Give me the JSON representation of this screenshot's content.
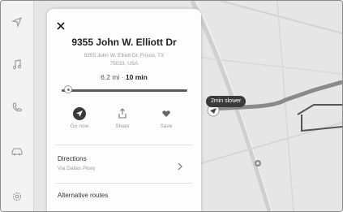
{
  "sidebar": {
    "items": [
      {
        "icon": "navigation-arrow-icon"
      },
      {
        "icon": "music-note-icon"
      },
      {
        "icon": "phone-icon"
      },
      {
        "icon": "car-icon"
      },
      {
        "icon": "settings-gear-icon"
      }
    ]
  },
  "panel": {
    "title": "9355 John W. Elliott Dr",
    "address_line1": "9355 John W. Elliott Dr, Frisco, TX",
    "address_line2": "75033, USA",
    "distance": "6.2 mi",
    "separator": "·",
    "duration": "10 min",
    "progress": 0.05,
    "actions": [
      {
        "label": "Go now",
        "icon": "navigation-arrow-icon"
      },
      {
        "label": "Share",
        "icon": "share-icon"
      },
      {
        "label": "Save",
        "icon": "heart-icon"
      }
    ],
    "directions": {
      "title": "Directions",
      "subtitle": "Via Dallas Pkwy"
    },
    "alternative_routes": {
      "title": "Alternative routes"
    }
  },
  "map": {
    "route_badge": "2min slower"
  }
}
